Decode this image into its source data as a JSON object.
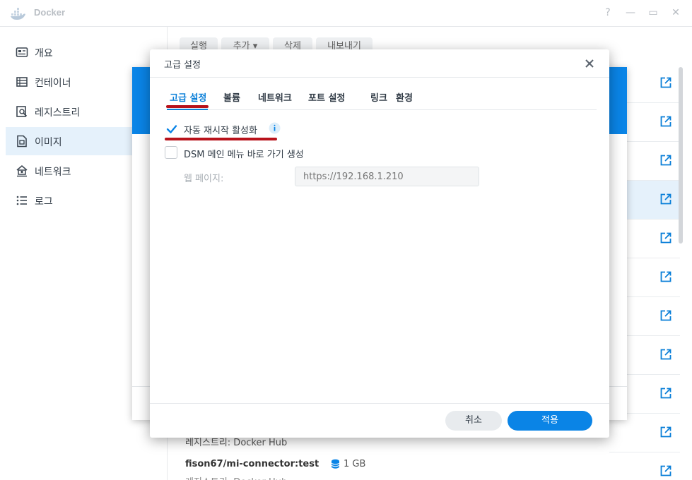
{
  "window": {
    "title": "Docker",
    "controls": [
      "?",
      "—",
      "▭",
      "✕"
    ]
  },
  "sidebar": {
    "items": [
      {
        "label": "개요",
        "icon": "overview-icon"
      },
      {
        "label": "컨테이너",
        "icon": "container-icon"
      },
      {
        "label": "레지스트리",
        "icon": "registry-icon"
      },
      {
        "label": "이미지",
        "icon": "image-icon",
        "active": true
      },
      {
        "label": "네트워크",
        "icon": "network-icon"
      },
      {
        "label": "로그",
        "icon": "log-icon"
      }
    ]
  },
  "background": {
    "toolbar": [
      "실행",
      "추가 ▾",
      "삭제",
      "내보내기"
    ],
    "registry_text": "레지스트리: Docker Hub",
    "image_name": "fison67/mi-connector:test",
    "image_size": "1 GB",
    "image_sub": "레지스트리: Docker Hub"
  },
  "modal": {
    "title": "고급 설정",
    "tabs": [
      "고급 설정",
      "볼륨",
      "네트워크",
      "포트 설정",
      "링크",
      "환경"
    ],
    "options": [
      {
        "label": "자동 재시작 활성화",
        "checked": true
      },
      {
        "label": "DSM 메인 메뉴 바로 가기 생성",
        "checked": false
      }
    ],
    "web_page_label": "웹 페이지:",
    "web_page_placeholder": "https://192.168.1.210",
    "cancel": "취소",
    "apply": "적용"
  },
  "colors": {
    "accent": "#0a84e6",
    "annotation": "#b8121b"
  }
}
